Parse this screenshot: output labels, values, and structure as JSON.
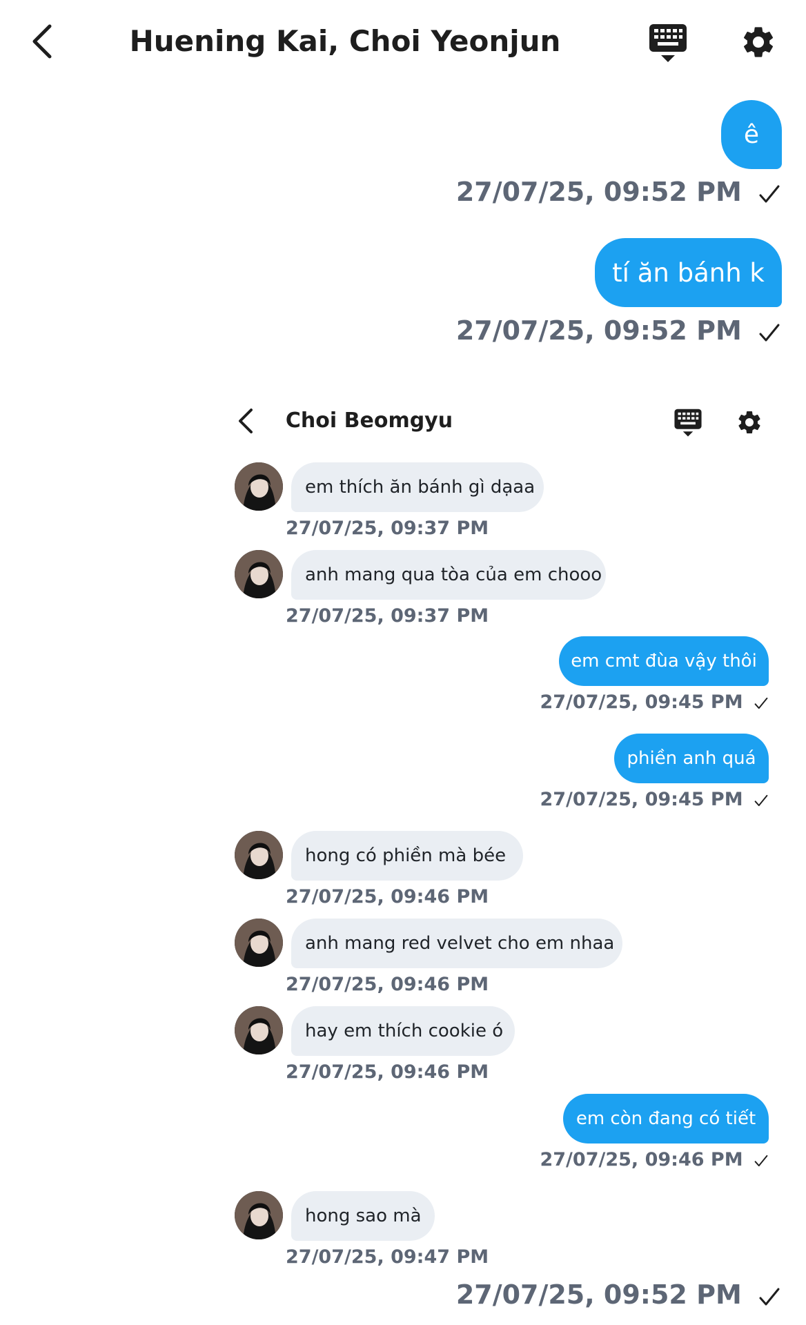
{
  "header": {
    "title": "Huening Kai, Choi Yeonjun"
  },
  "outer_messages": [
    {
      "text": "ê",
      "time": "27/07/25, 09:52 PM"
    },
    {
      "text": "tí ăn bánh k",
      "time": "27/07/25, 09:52 PM"
    }
  ],
  "screenshot": {
    "header": {
      "title": "Choi Beomgyu"
    },
    "messages": [
      {
        "dir": "in",
        "text": "em thích ăn bánh gì dạaa",
        "time": "27/07/25, 09:37 PM"
      },
      {
        "dir": "in",
        "text": "anh mang qua tòa của em chooo",
        "time": "27/07/25, 09:37 PM"
      },
      {
        "dir": "out",
        "text": "em cmt đùa vậy thôi",
        "time": "27/07/25, 09:45 PM"
      },
      {
        "dir": "out",
        "text": "phiền anh quá",
        "time": "27/07/25, 09:45 PM"
      },
      {
        "dir": "in",
        "text": "hong có phiền mà bée",
        "time": "27/07/25, 09:46 PM"
      },
      {
        "dir": "in",
        "text": "anh mang red velvet cho em nhaa",
        "time": "27/07/25, 09:46 PM"
      },
      {
        "dir": "in",
        "text": "hay em thích cookie ó",
        "time": "27/07/25, 09:46 PM"
      },
      {
        "dir": "out",
        "text": "em còn đang có tiết",
        "time": "27/07/25, 09:46 PM"
      },
      {
        "dir": "in",
        "text": "hong sao mà",
        "time": "27/07/25, 09:47 PM"
      }
    ],
    "footer_time": "27/07/25, 09:52 PM"
  },
  "icons": {
    "back": "chevron-left-icon",
    "keyboard": "keyboard-icon",
    "settings": "gear-icon",
    "read": "checkmark-icon"
  },
  "colors": {
    "outgoing_bubble": "#1ca1f1",
    "incoming_bubble": "#eaeef3",
    "timestamp": "#5d6675"
  }
}
